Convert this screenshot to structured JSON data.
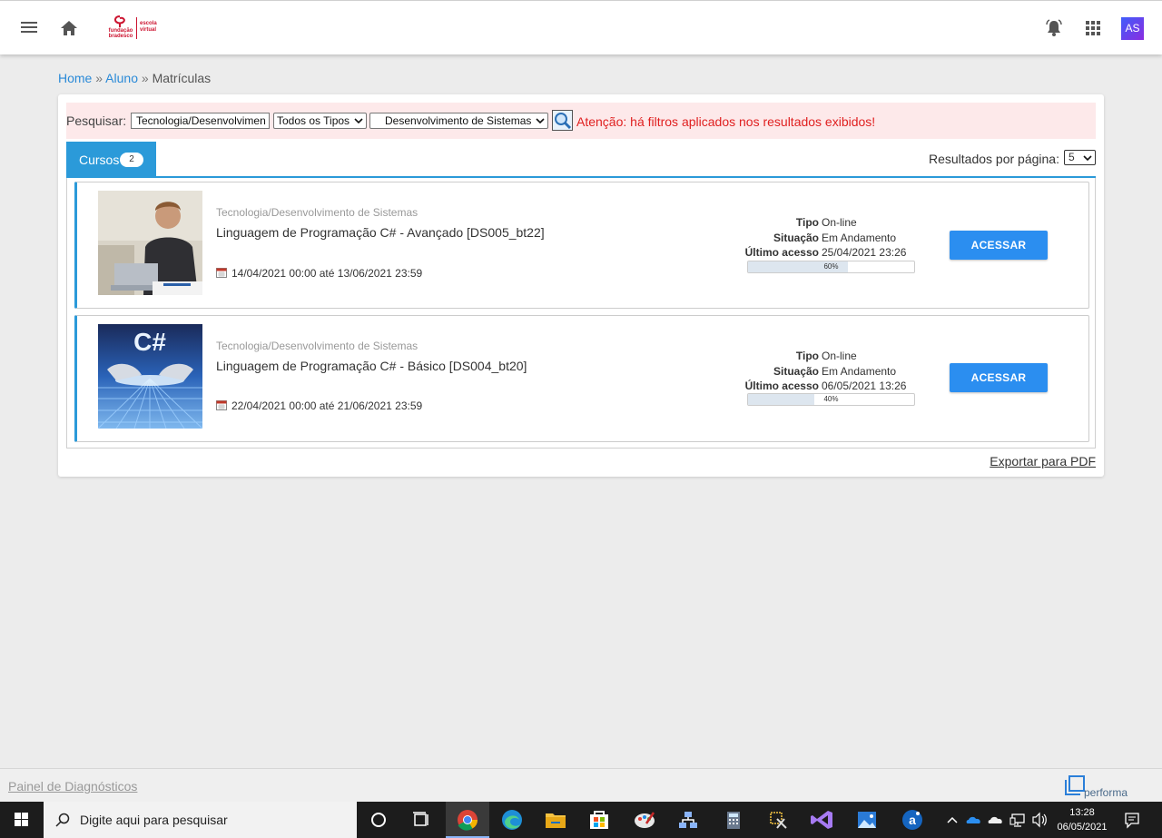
{
  "header": {
    "logo_left": "fundação bradesco",
    "logo_right": "escola virtual",
    "avatar_initials": "AS"
  },
  "breadcrumb": {
    "home": "Home",
    "sep": "»",
    "aluno": "Aluno",
    "current": "Matrículas"
  },
  "filters": {
    "label": "Pesquisar:",
    "search_value": "Tecnologia/Desenvolvimen",
    "type_selected": "Todos os Tipos",
    "area_selected": "Desenvolvimento de Sistemas",
    "warning": "Atenção: há filtros aplicados nos resultados exibidos!",
    "warning_color": "#e02020"
  },
  "tabs": {
    "cursos_label": "Cursos",
    "cursos_count": "2"
  },
  "per_page": {
    "label": "Resultados por página:",
    "value": "5"
  },
  "courses": [
    {
      "area": "Tecnologia/Desenvolvimento de Sistemas",
      "title": "Linguagem de Programação C# - Avançado [DS005_bt22]",
      "dates": "14/04/2021 00:00 até 13/06/2021 23:59",
      "tipo_label": "Tipo",
      "tipo": "On-line",
      "situacao_label": "Situação",
      "situacao": "Em Andamento",
      "ultimo_label": "Último acesso",
      "ultimo": "25/04/2021 23:26",
      "progress": 60,
      "progress_text": "60%",
      "button": "ACESSAR"
    },
    {
      "area": "Tecnologia/Desenvolvimento de Sistemas",
      "title": "Linguagem de Programação C# - Básico [DS004_bt20]",
      "dates": "22/04/2021 00:00 até 21/06/2021 23:59",
      "tipo_label": "Tipo",
      "tipo": "On-line",
      "situacao_label": "Situação",
      "situacao": "Em Andamento",
      "ultimo_label": "Último acesso",
      "ultimo": "06/05/2021 13:26",
      "progress": 40,
      "progress_text": "40%",
      "button": "ACESSAR"
    }
  ],
  "export_label": "Exportar para PDF",
  "footer": {
    "diag": "Painel de Diagnósticos",
    "brand": "performa"
  },
  "taskbar": {
    "search_placeholder": "Digite aqui para pesquisar",
    "time": "13:28",
    "date": "06/05/2021"
  },
  "colors": {
    "accent": "#2b9ad9",
    "button": "#2b8ef0",
    "brand_red": "#cc1430"
  }
}
